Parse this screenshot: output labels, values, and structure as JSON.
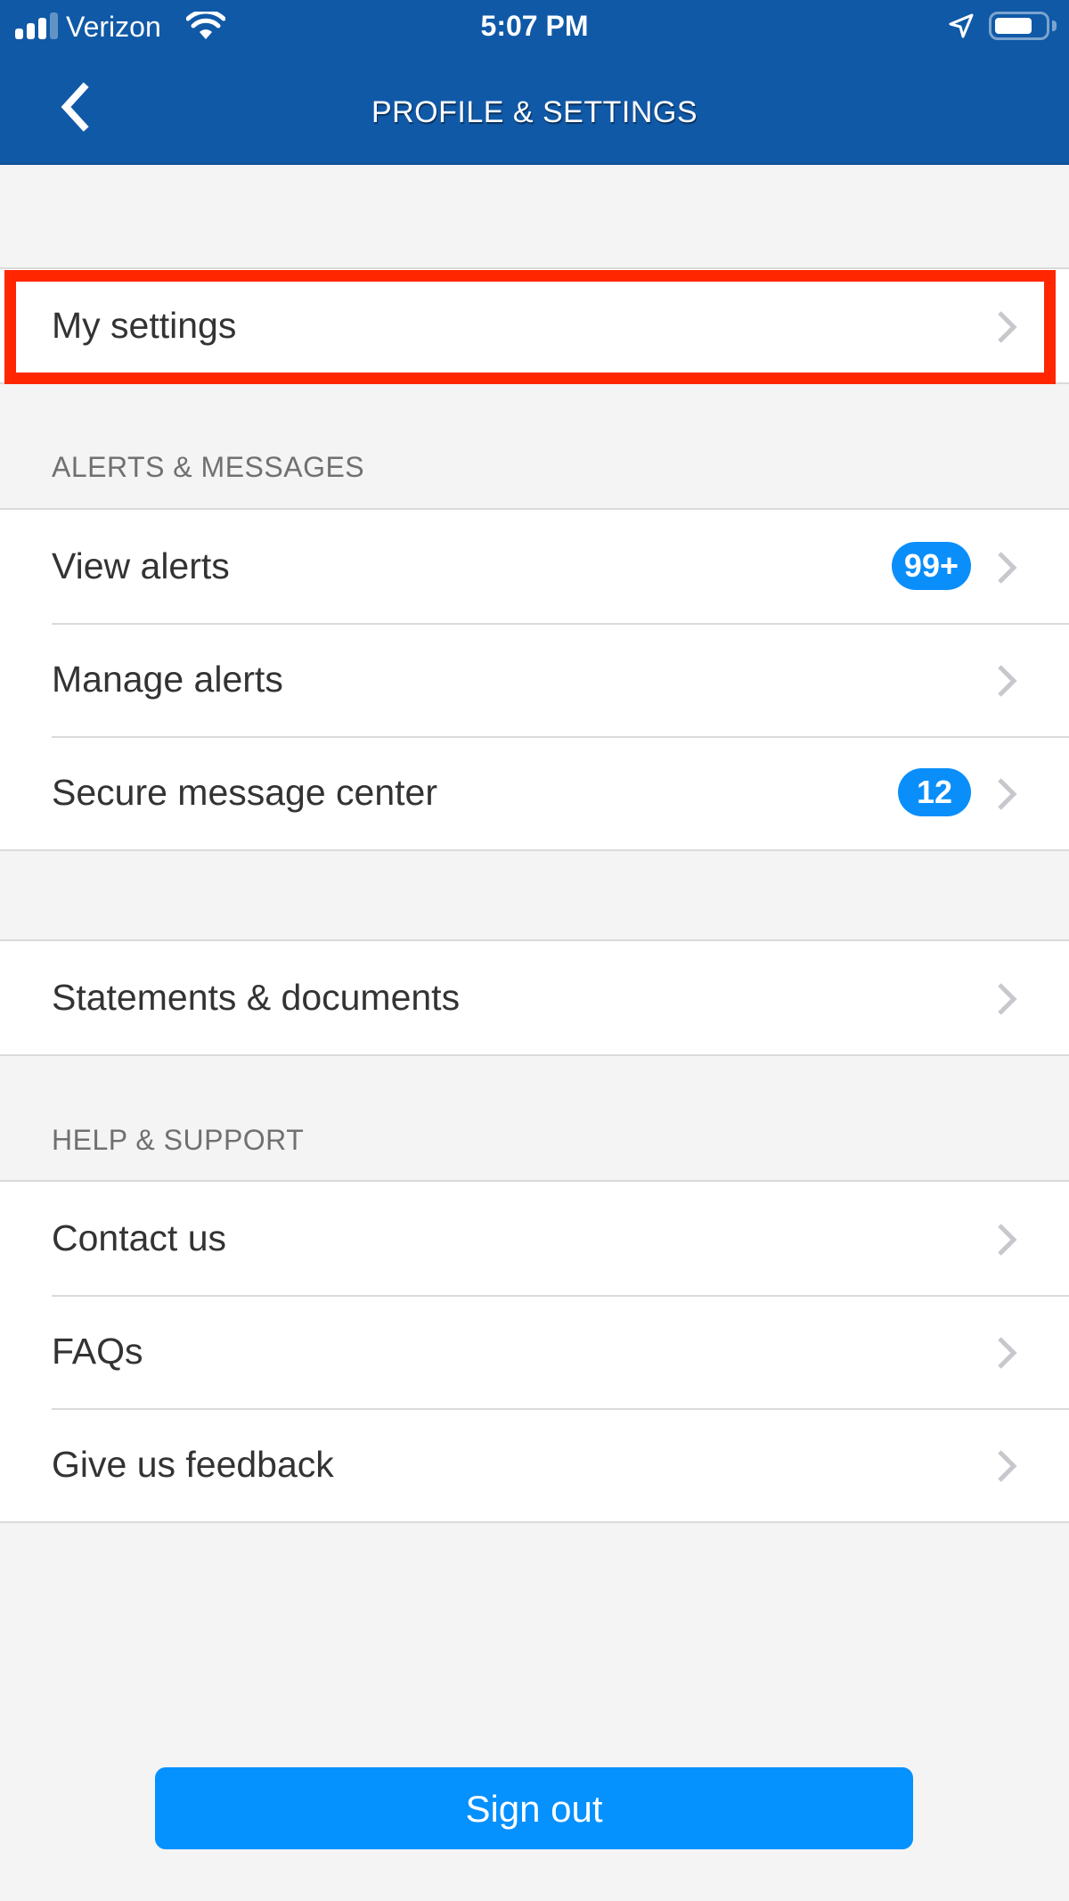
{
  "status_bar": {
    "carrier": "Verizon",
    "time": "5:07 PM",
    "signal_bars_filled": 3,
    "signal_bars_total": 4,
    "battery_level": 0.75,
    "icons": [
      "signal-icon",
      "wifi-icon",
      "location-arrow-icon",
      "battery-icon"
    ]
  },
  "header": {
    "title": "PROFILE & SETTINGS",
    "back_icon": "chevron-left-icon",
    "background_color": "#1059a7"
  },
  "groups": [
    {
      "section_label": null,
      "items": [
        {
          "label": "My settings",
          "badge": null,
          "highlighted": true
        }
      ]
    },
    {
      "section_label": "ALERTS & MESSAGES",
      "items": [
        {
          "label": "View alerts",
          "badge": "99+"
        },
        {
          "label": "Manage alerts",
          "badge": null
        },
        {
          "label": "Secure message center",
          "badge": "12"
        }
      ]
    },
    {
      "section_label": null,
      "items": [
        {
          "label": "Statements & documents",
          "badge": null
        }
      ]
    },
    {
      "section_label": "HELP & SUPPORT",
      "items": [
        {
          "label": "Contact us",
          "badge": null
        },
        {
          "label": "FAQs",
          "badge": null
        },
        {
          "label": "Give us feedback",
          "badge": null
        }
      ]
    }
  ],
  "footer": {
    "sign_out_label": "Sign out"
  },
  "colors": {
    "accent": "#0591fe",
    "badge": "#0a8efa",
    "highlight_border": "#ff2600",
    "chevron": "#c7c7cc",
    "background": "#f4f4f4"
  }
}
